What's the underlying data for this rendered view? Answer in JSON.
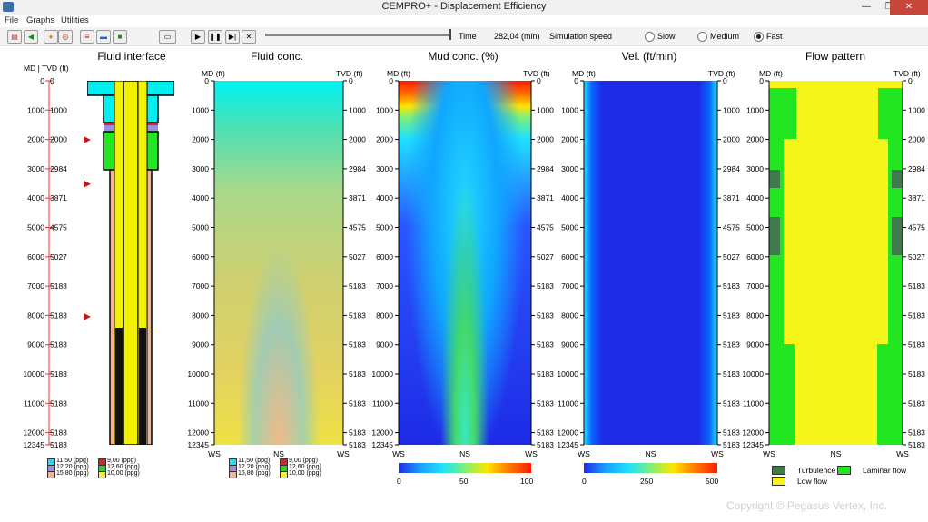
{
  "window": {
    "title": "CEMPRO+ - Displacement Efficiency",
    "minimize": "—",
    "maximize": "❐",
    "close": "✕"
  },
  "menu": [
    "File",
    "Graphs",
    "Utilities"
  ],
  "toolbar": {
    "time_label": "Time",
    "time_value": "282,04 (min)",
    "speed_label": "Simulation speed",
    "speeds": [
      "Slow",
      "Medium",
      "Fast"
    ],
    "selected_speed": "Fast",
    "playback_position": 1.0
  },
  "depth_axis": {
    "header": "MD | TVD (ft)",
    "md": [
      "0",
      "1000",
      "2000",
      "3000",
      "4000",
      "5000",
      "6000",
      "7000",
      "8000",
      "9000",
      "10000",
      "11000",
      "12000",
      "12345"
    ],
    "tvd": [
      "0",
      "1000",
      "2000",
      "2984",
      "3871",
      "4575",
      "5027",
      "5183",
      "5183",
      "5183",
      "5183",
      "5183",
      "5183",
      "5183"
    ],
    "marker_depths_ft": [
      2000,
      3500,
      8000
    ]
  },
  "panels": {
    "fluid_interface": {
      "title": "Fluid interface"
    },
    "fluid_conc": {
      "title": "Fluid conc.",
      "md_label": "MD (ft)",
      "tvd_label": "TVD (ft)",
      "x_ticks": [
        "WS",
        "NS",
        "WS"
      ]
    },
    "mud_conc": {
      "title": "Mud conc. (%)",
      "md_label": "MD (ft)",
      "tvd_label": "TVD (ft)",
      "x_ticks": [
        "WS",
        "NS",
        "WS"
      ],
      "scale": [
        "0",
        "50",
        "100"
      ]
    },
    "velocity": {
      "title": "Vel. (ft/min)",
      "md_label": "MD (ft)",
      "tvd_label": "TVD (ft)",
      "x_ticks": [
        "WS",
        "NS",
        "WS"
      ],
      "scale": [
        "0",
        "250",
        "500"
      ]
    },
    "flow_pattern": {
      "title": "Flow pattern",
      "md_label": "MD (ft)",
      "tvd_label": "TVD (ft)",
      "x_ticks": [
        "WS",
        "NS",
        "WS"
      ]
    }
  },
  "fluid_legend": [
    {
      "label": "11,50 (ppg)",
      "color": "#2fd8e8"
    },
    {
      "label": "9,00 (ppg)",
      "color": "#c62a2a"
    },
    {
      "label": "12,20 (ppg)",
      "color": "#9a8fe0"
    },
    {
      "label": "12,60 (ppg)",
      "color": "#33cc33"
    },
    {
      "label": "15,80 (ppg)",
      "color": "#f0b58e"
    },
    {
      "label": "10,00 (ppg)",
      "color": "#f2f23a"
    }
  ],
  "flow_legend": [
    {
      "label": "Turbulence",
      "color": "#3f7a4a"
    },
    {
      "label": "Laminar flow",
      "color": "#22e622"
    },
    {
      "label": "Low flow",
      "color": "#f5f51a"
    }
  ],
  "colors": {
    "cyan": "#00f0f0",
    "yellow": "#f2f200",
    "green": "#22e622",
    "dark_green": "#3f7a4a",
    "blue": "#1e2be6",
    "red": "#ff1a00"
  },
  "copyright": "Copyright © Pegasus Vertex, Inc."
}
